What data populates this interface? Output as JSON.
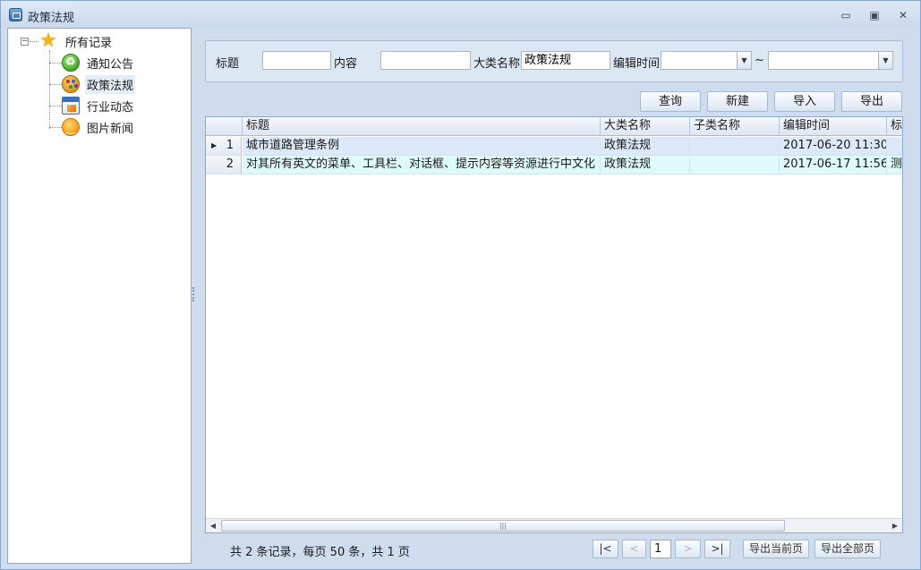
{
  "window": {
    "title": "政策法规",
    "icon": "app-window-icon",
    "controls": [
      "minimize-icon",
      "restore-icon",
      "close-icon"
    ]
  },
  "tree": {
    "root": {
      "label": "所有记录",
      "icon": "star-icon",
      "expander": "⊟"
    },
    "children": [
      {
        "label": "通知公告",
        "icon": "recycle-globe-icon"
      },
      {
        "label": "政策法规",
        "icon": "palette-icon",
        "selected": true
      },
      {
        "label": "行业动态",
        "icon": "document-chart-icon"
      },
      {
        "label": "图片新闻",
        "icon": "smiley-icon"
      }
    ]
  },
  "search": {
    "title_label": "标题",
    "title_value": "",
    "content_label": "内容",
    "content_value": "",
    "category_label": "大类名称",
    "category_value": "政策法规",
    "edit_time_label": "编辑时间",
    "date_from": "",
    "date_to": "",
    "range_sep": "~"
  },
  "toolbar": {
    "query": "查询",
    "new": "新建",
    "import": "导入",
    "export": "导出"
  },
  "grid": {
    "columns": [
      "标题",
      "大类名称",
      "子类名称",
      "编辑时间",
      "标签"
    ],
    "rows": [
      {
        "num": "1",
        "title": "城市道路管理条例",
        "category": "政策法规",
        "subcategory": "",
        "edit_time": "2017-06-20 11:30",
        "tag": "",
        "current": true
      },
      {
        "num": "2",
        "title": "对其所有英文的菜单、工具栏、对话框、提示内容等资源进行中文化",
        "category": "政策法规",
        "subcategory": "",
        "edit_time": "2017-06-17 11:56",
        "tag": "测试"
      }
    ],
    "row_colors": [
      "#dbe9fa",
      "#dffafa"
    ]
  },
  "pager": {
    "summary": "共 2 条记录，每页 50 条，共 1 页",
    "first": "|<",
    "prev": "<",
    "page": "1",
    "next": ">",
    "last": ">|",
    "export_current": "导出当前页",
    "export_all": "导出全部页"
  }
}
